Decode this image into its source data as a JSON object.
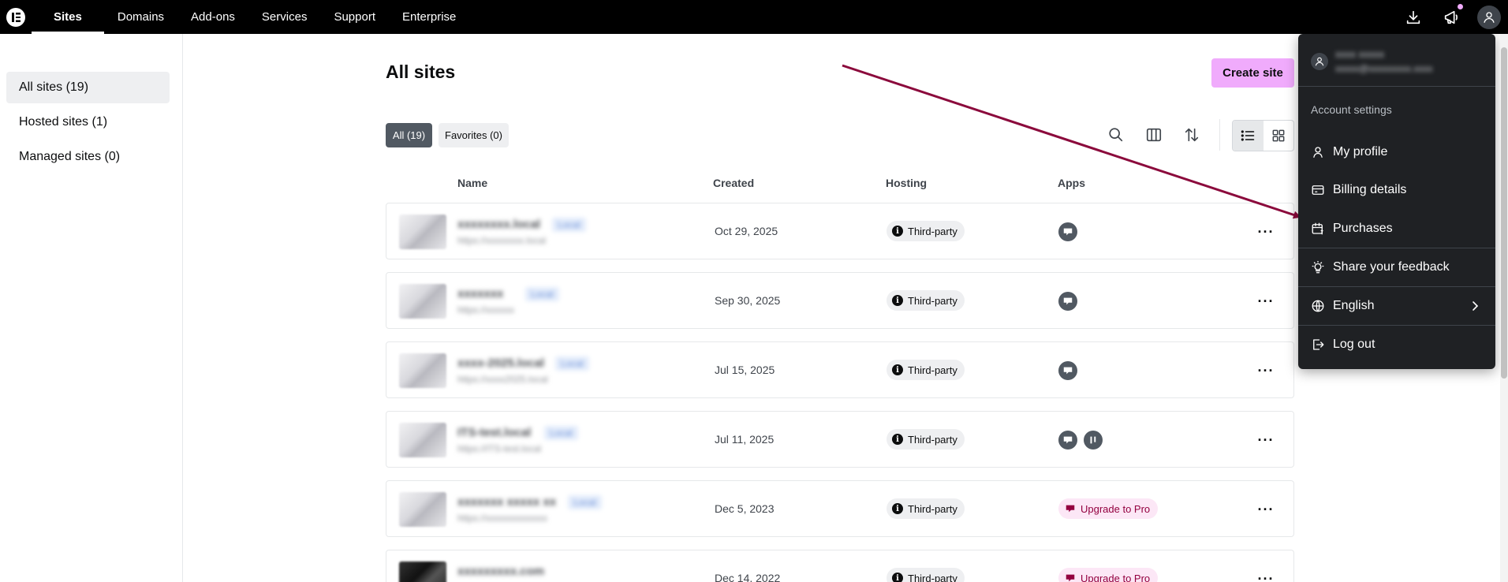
{
  "nav": {
    "logo": "elementor-logo-icon",
    "items": [
      {
        "label": "Sites",
        "active": true
      },
      {
        "label": "Domains"
      },
      {
        "label": "Add-ons"
      },
      {
        "label": "Services"
      },
      {
        "label": "Support"
      },
      {
        "label": "Enterprise"
      }
    ],
    "icons": [
      "download-icon",
      "megaphone-icon",
      "user-avatar-icon"
    ]
  },
  "sidebar": {
    "items": [
      {
        "label": "All sites (19)",
        "active": true
      },
      {
        "label": "Hosted sites (1)"
      },
      {
        "label": "Managed sites (0)"
      }
    ]
  },
  "main": {
    "title": "All sites",
    "create_label": "Create site",
    "filters": [
      {
        "label": "All (19)",
        "active": true
      },
      {
        "label": "Favorites (0)"
      }
    ],
    "columns": {
      "name": "Name",
      "created": "Created",
      "hosting": "Hosting",
      "apps": "Apps"
    },
    "rows": [
      {
        "name": "xxxxxxxx.local",
        "badge": "Local",
        "url": "https://xxxxxxxx.local",
        "created": "Oct 29, 2025",
        "hosting": "Third-party",
        "apps": [
          "site-app-icon"
        ]
      },
      {
        "name": "xxxxxxx",
        "badge": "Local",
        "url": "https://xxxxxx",
        "created": "Sep 30, 2025",
        "hosting": "Third-party",
        "apps": [
          "site-app-icon"
        ]
      },
      {
        "name": "xxxx-2025.local",
        "badge": "Local",
        "url": "https://xxxx2025.local",
        "created": "Jul 15, 2025",
        "hosting": "Third-party",
        "apps": [
          "site-app-icon"
        ]
      },
      {
        "name": "ITS-test.local",
        "badge": "Local",
        "url": "https://ITS-test.local",
        "created": "Jul 11, 2025",
        "hosting": "Third-party",
        "apps": [
          "site-app-icon",
          "pause-app-icon"
        ]
      },
      {
        "name": "xxxxxxx xxxxx xx",
        "badge": "Local",
        "url": "https://xxxxxxxxxxxxx",
        "created": "Dec 5, 2023",
        "hosting": "Third-party",
        "upgrade": "Upgrade to Pro"
      },
      {
        "name": "xxxxxxxxx.com",
        "badge": "",
        "url": "",
        "created": "Dec 14, 2022",
        "hosting": "Third-party",
        "upgrade": "Upgrade to Pro"
      }
    ]
  },
  "account_menu": {
    "user_name": "xxxx xxxxx",
    "user_email": "xxxxx@xxxxxxxxx.xxxx",
    "section_label": "Account settings",
    "items": [
      {
        "label": "My profile",
        "icon": "person-icon"
      },
      {
        "label": "Billing details",
        "icon": "credit-card-icon"
      },
      {
        "label": "Purchases",
        "icon": "calendar-dollar-icon"
      },
      {
        "label": "Share your feedback",
        "icon": "lightbulb-icon"
      },
      {
        "label": "English",
        "icon": "globe-icon",
        "has_submenu": true
      },
      {
        "label": "Log out",
        "icon": "logout-icon"
      }
    ]
  },
  "colors": {
    "nav_bg": "#000000",
    "accent_pink": "#f0abfc",
    "dropdown_bg": "#1f2124",
    "annotation_arrow": "#8b0a3c",
    "upgrade_text": "#93003f"
  }
}
